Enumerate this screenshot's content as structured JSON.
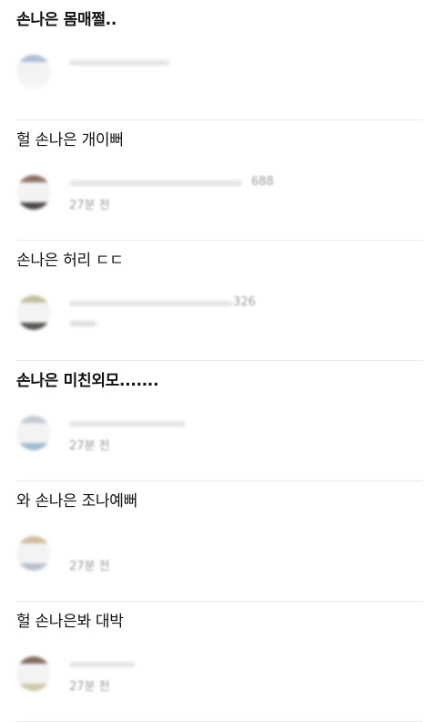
{
  "posts": [
    {
      "title": "손나은 몸매쩔..",
      "bold": true,
      "author_count": "",
      "time_ago": "",
      "avatar_colors": [
        "#9fb3cc",
        "#f4f4f4"
      ]
    },
    {
      "title": "헐 손나은 개이뻐",
      "bold": false,
      "author_count": "688",
      "time_ago": "27분 전",
      "avatar_colors": [
        "#7a5a4a",
        "#2f2a28"
      ]
    },
    {
      "title": "손나은 허리 ㄷㄷ",
      "bold": false,
      "author_count": "326",
      "time_ago": "",
      "avatar_colors": [
        "#b9b48a",
        "#3b3a35"
      ]
    },
    {
      "title": "손나은 미친외모.......",
      "bold": true,
      "author_count": "",
      "time_ago": "27분 전",
      "avatar_colors": [
        "#b8c3cc",
        "#8fb0c8"
      ]
    },
    {
      "title": "와 손나은 조나예뻐",
      "bold": false,
      "author_count": "",
      "time_ago": "27분 전",
      "avatar_colors": [
        "#c8b089",
        "#aab7c6"
      ]
    },
    {
      "title": "헐 손나은봐 대박",
      "bold": false,
      "author_count": "",
      "time_ago": "27분 전",
      "avatar_colors": [
        "#6e5246",
        "#c6c09a"
      ]
    }
  ]
}
